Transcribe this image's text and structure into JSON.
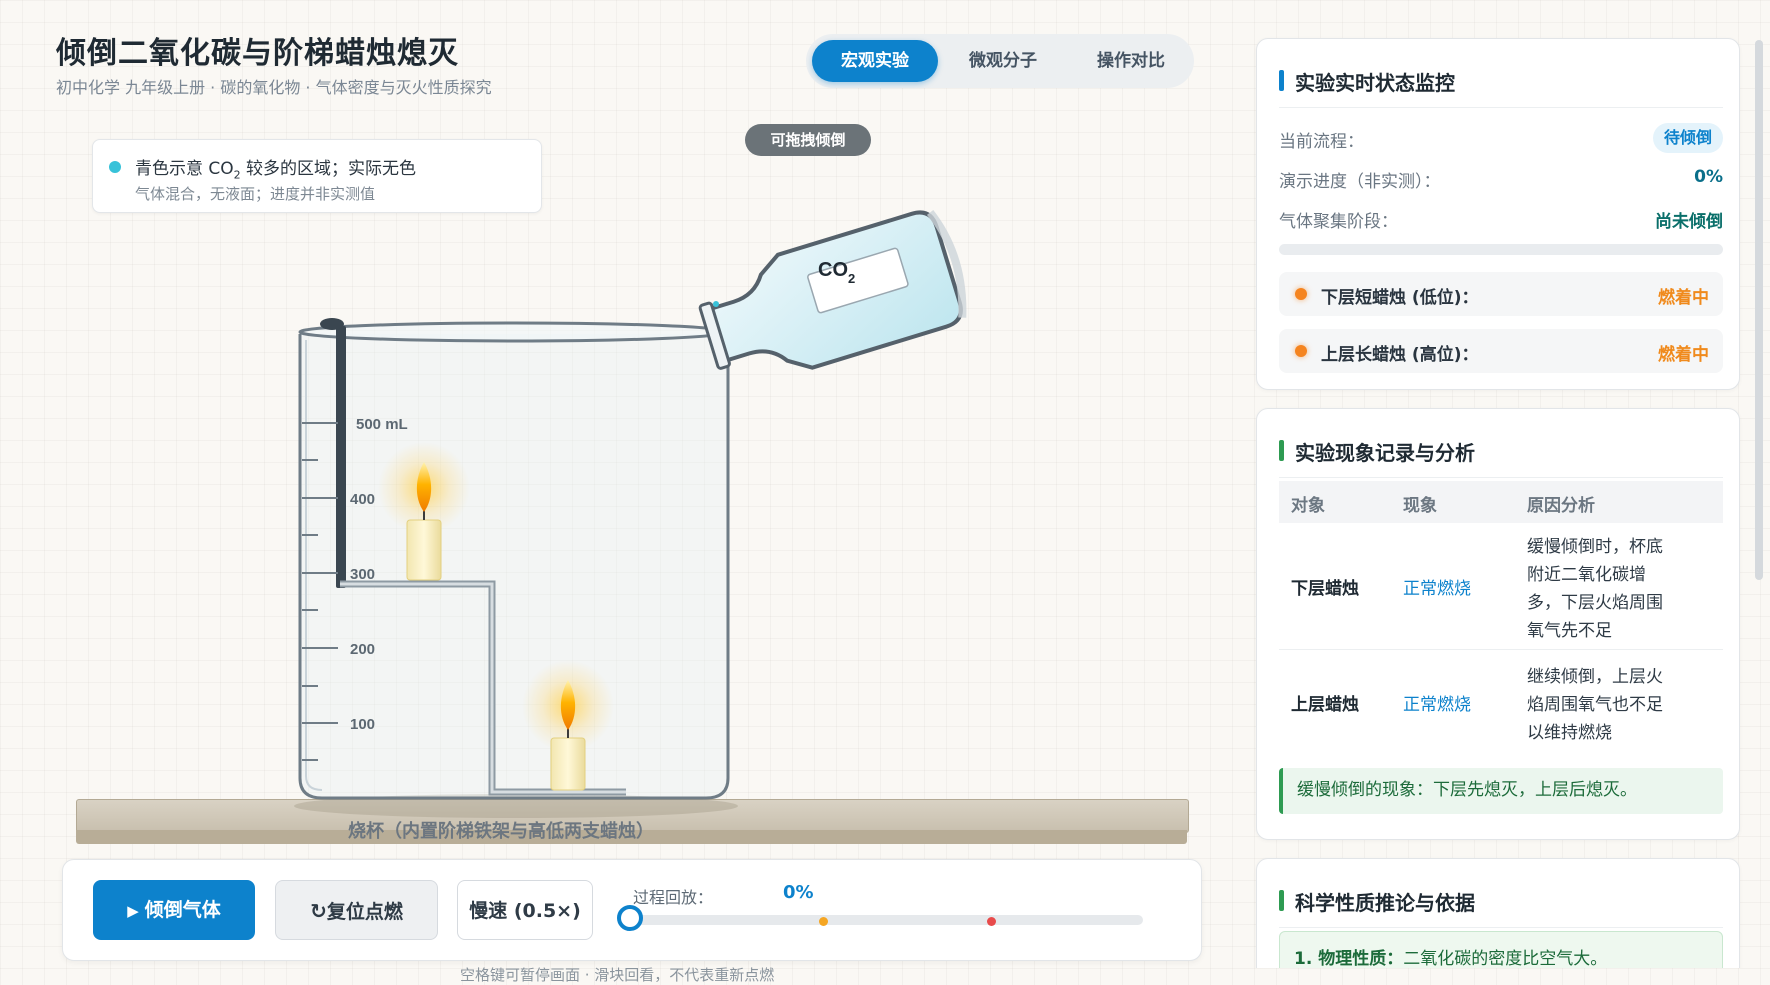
{
  "header": {
    "title": "倾倒二氧化碳与阶梯蜡烛熄灭",
    "subtitle": "初中化学 九年级上册 · 碳的氧化物 · 气体密度与灭火性质探究"
  },
  "view_tabs": [
    {
      "label": "宏观实验",
      "active": true
    },
    {
      "label": "微观分子",
      "active": false
    },
    {
      "label": "操作对比",
      "active": false
    }
  ],
  "drag_hint": "可拖拽倾倒",
  "legend": {
    "line1_prefix": "青色示意 CO",
    "line1_sub": "2",
    "line1_suffix": " 较多的区域；实际无色",
    "line2": "气体混合，无液面；进度并非实测值",
    "dot_color": "#38c2d9"
  },
  "bottle": {
    "label": "CO",
    "label_sub": "2"
  },
  "beaker": {
    "scale_labels": [
      "500 mL",
      "400",
      "300",
      "200",
      "100"
    ],
    "caption": "烧杯（内置阶梯铁架与高低两支蜡烛）"
  },
  "controls": {
    "pour_label": "倾倒气体",
    "reset_label": "复位点燃",
    "speed_label": "慢速 (0.5×)",
    "replay_label": "过程回放：",
    "replay_value": "0%",
    "progress_fraction": 0,
    "markers": [
      {
        "fraction": 0.37,
        "color": "#f5a623"
      },
      {
        "fraction": 0.7,
        "color": "#e84b4b"
      }
    ]
  },
  "hint": "空格键可暂停画面 · 滑块回看，不代表重新点燃",
  "status_card": {
    "title": "实验实时状态监控",
    "rows": [
      {
        "label": "当前流程：",
        "value": "待倾倒"
      },
      {
        "label": "演示进度（非实测）：",
        "value": "0%"
      },
      {
        "label": "气体聚集阶段：",
        "value": "尚未倾倒"
      }
    ],
    "progress_fraction": 0,
    "candles": [
      {
        "label": "下层短蜡烛 (低位)：",
        "value": "燃着中"
      },
      {
        "label": "上层长蜡烛 (高位)：",
        "value": "燃着中"
      }
    ],
    "accent": "#0d82cc"
  },
  "record_card": {
    "title": "实验现象记录与分析",
    "headers": [
      "对象",
      "现象",
      "原因分析"
    ],
    "rows": [
      {
        "object": "下层蜡烛",
        "phenomenon": "正常燃烧",
        "reason": "缓慢倾倒时，杯底附近二氧化碳增多，下层火焰周围氧气先不足"
      },
      {
        "object": "上层蜡烛",
        "phenomenon": "正常燃烧",
        "reason": "继续倾倒，上层火焰周围氧气也不足以维持燃烧"
      }
    ],
    "conclusion": "缓慢倾倒的现象：下层先熄灭，上层后熄灭。",
    "accent": "#2e9b52"
  },
  "inference_card": {
    "title": "科学性质推论与依据",
    "item_label": "1. 物理性质：",
    "item_text": "二氧化碳的密度比空气大。",
    "accent": "#2e9b52"
  }
}
